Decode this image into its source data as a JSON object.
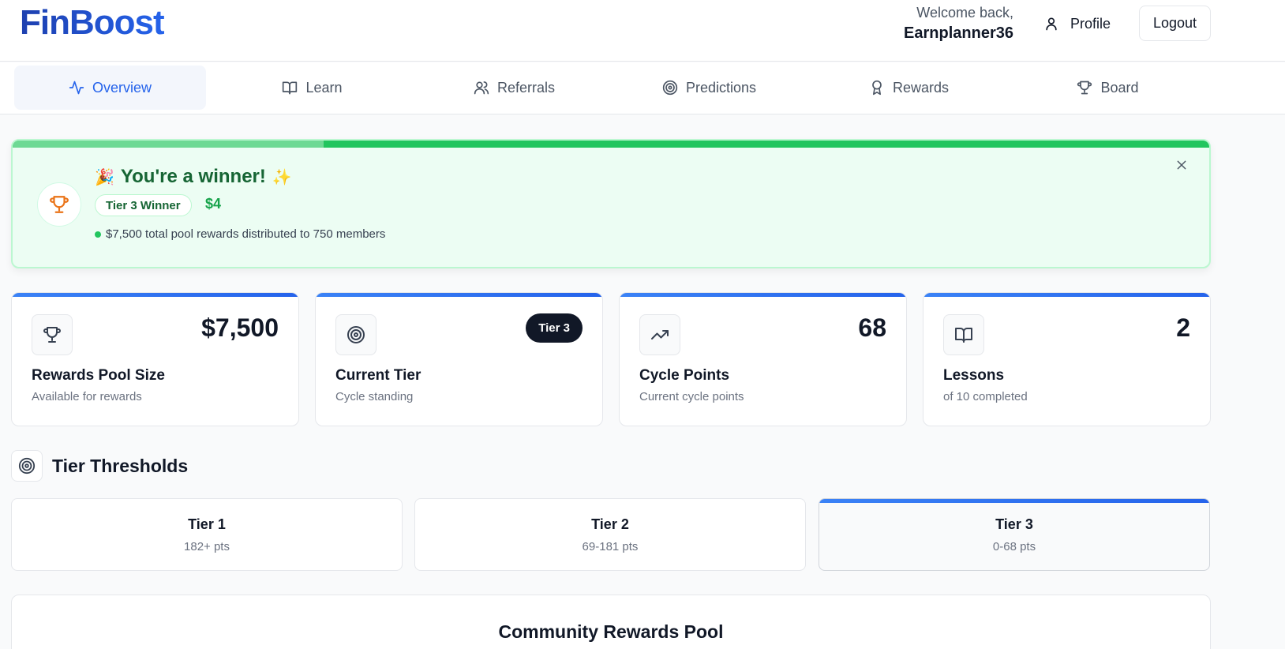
{
  "app": {
    "logo": "FinBoost"
  },
  "header": {
    "welcome_line": "Welcome back,",
    "username": "Earnplanner36",
    "profile_label": "Profile",
    "logout_label": "Logout"
  },
  "nav": {
    "tabs": [
      {
        "label": "Overview",
        "icon": "activity-icon",
        "active": true
      },
      {
        "label": "Learn",
        "icon": "book-open-icon"
      },
      {
        "label": "Referrals",
        "icon": "users-icon"
      },
      {
        "label": "Predictions",
        "icon": "target-icon"
      },
      {
        "label": "Rewards",
        "icon": "award-icon"
      },
      {
        "label": "Board",
        "icon": "trophy-icon"
      }
    ]
  },
  "banner": {
    "emoji_left": "🎉",
    "title": "You're a winner!",
    "emoji_right": "✨",
    "tier_label": "Tier 3 Winner",
    "amount": "$4",
    "pool_note": "$7,500 total pool rewards distributed to 750 members",
    "progress": 0.26
  },
  "stats": [
    {
      "icon": "trophy-icon",
      "value": "$7,500",
      "title": "Rewards Pool Size",
      "sub": "Available for rewards"
    },
    {
      "icon": "target-icon",
      "badge": "Tier 3",
      "title": "Current Tier",
      "sub": "Cycle standing"
    },
    {
      "icon": "trending-up-icon",
      "value": "68",
      "title": "Cycle Points",
      "sub": "Current cycle points"
    },
    {
      "icon": "book-open-icon",
      "value": "2",
      "title": "Lessons",
      "sub": "of 10 completed"
    }
  ],
  "tiers": {
    "title": "Tier Thresholds",
    "items": [
      {
        "name": "Tier 1",
        "range": "182+ pts"
      },
      {
        "name": "Tier 2",
        "range": "69-181 pts"
      },
      {
        "name": "Tier 3",
        "range": "0-68 pts",
        "current": true
      }
    ]
  },
  "community_pool": {
    "title": "Community Rewards Pool"
  },
  "colors": {
    "brand": "#2563eb",
    "success": "#22c55e",
    "dark_badge": "#111827"
  }
}
